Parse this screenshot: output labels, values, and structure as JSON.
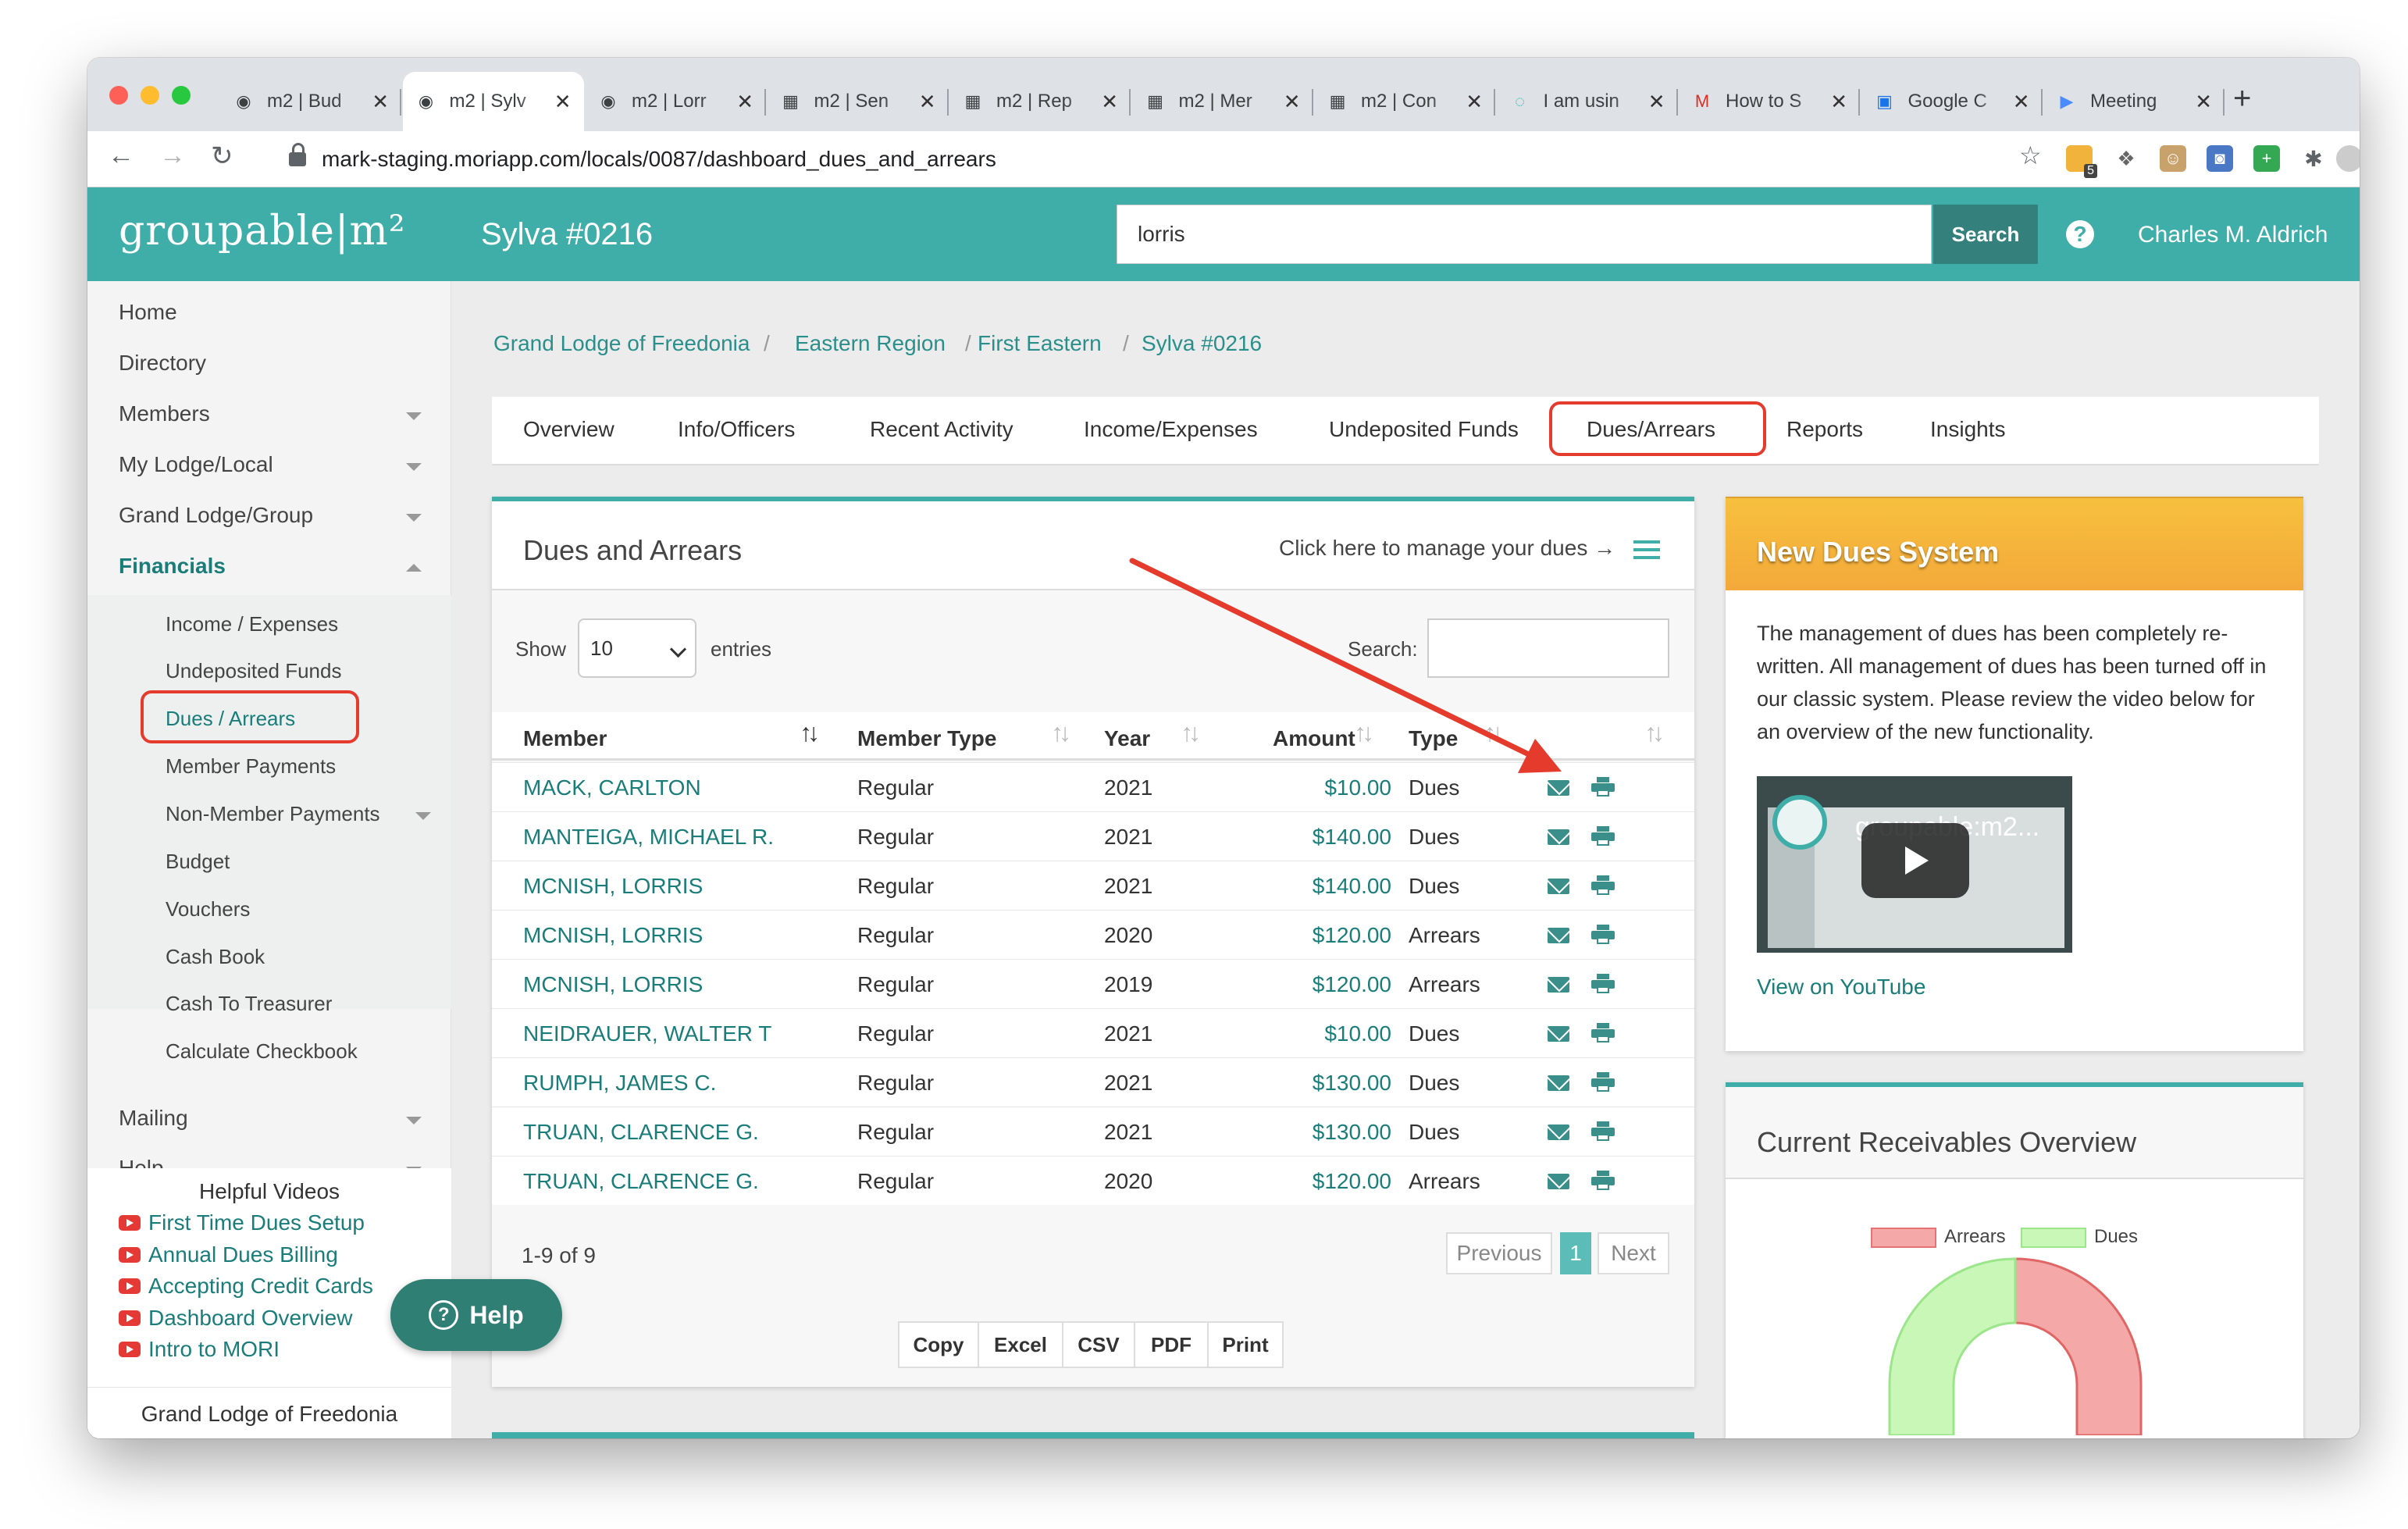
{
  "browser": {
    "tabs": [
      {
        "title": "m2 | Bud",
        "icon": "globe-icon",
        "active": false
      },
      {
        "title": "m2 | Sylv",
        "icon": "globe-icon",
        "active": true
      },
      {
        "title": "m2 | Lorr",
        "icon": "globe-icon",
        "active": false
      },
      {
        "title": "m2 | Sen",
        "icon": "qr-icon",
        "active": false
      },
      {
        "title": "m2 | Rep",
        "icon": "qr-icon",
        "active": false
      },
      {
        "title": "m2 | Mer",
        "icon": "qr-icon",
        "active": false
      },
      {
        "title": "m2 | Con",
        "icon": "qr-icon",
        "active": false
      },
      {
        "title": "I am usin",
        "icon": "swirl-icon",
        "active": false
      },
      {
        "title": "How to S",
        "icon": "gmail-icon",
        "active": false
      },
      {
        "title": "Google C",
        "icon": "calendar-icon",
        "active": false
      },
      {
        "title": "Meeting",
        "icon": "video-icon",
        "active": false
      }
    ],
    "url": "mark-staging.moriapp.com/locals/0087/dashboard_dues_and_arrears",
    "extension_badge": "5"
  },
  "header": {
    "logo": "groupable|m²",
    "lodge": "Sylva #0216",
    "search_value": "lorris",
    "search_button": "Search",
    "help_icon": "?",
    "user": "Charles M. Aldrich",
    "accent_color": "#3fada8"
  },
  "sidebar": {
    "items": [
      "Home",
      "Directory",
      "Members",
      "My Lodge/Local",
      "Grand Lodge/Group",
      "Financials"
    ],
    "financials_sub": [
      "Income / Expenses",
      "Undeposited Funds",
      "Dues / Arrears",
      "Member Payments",
      "Non-Member Payments",
      "Budget",
      "Vouchers",
      "Cash Book",
      "Cash To Treasurer",
      "Calculate Checkbook"
    ],
    "more": [
      "Mailing",
      "Help"
    ],
    "helpful_title": "Helpful Videos",
    "videos": [
      "First Time Dues Setup",
      "Annual Dues Billing",
      "Accepting Credit Cards",
      "Dashboard Overview",
      "Intro to MORI"
    ],
    "footer": "Grand Lodge of Freedonia"
  },
  "breadcrumb": [
    "Grand Lodge of Freedonia",
    "Eastern Region",
    "First Eastern",
    "Sylva #0216"
  ],
  "page_tabs": [
    "Overview",
    "Info/Officers",
    "Recent Activity",
    "Income/Expenses",
    "Undeposited Funds",
    "Dues/Arrears",
    "Reports",
    "Insights"
  ],
  "dues": {
    "title": "Dues and Arrears",
    "manage_link": "Click here to manage your dues →",
    "show_label": "Show",
    "show_value": "10",
    "entries_label": "entries",
    "search_label": "Search:",
    "columns": [
      "Member",
      "Member Type",
      "Year",
      "Amount",
      "Type"
    ],
    "rows": [
      {
        "member": "MACK, CARLTON",
        "type": "Regular",
        "year": "2021",
        "amount": "$10.00",
        "kind": "Dues"
      },
      {
        "member": "MANTEIGA, MICHAEL R.",
        "type": "Regular",
        "year": "2021",
        "amount": "$140.00",
        "kind": "Dues"
      },
      {
        "member": "MCNISH, LORRIS",
        "type": "Regular",
        "year": "2021",
        "amount": "$140.00",
        "kind": "Dues"
      },
      {
        "member": "MCNISH, LORRIS",
        "type": "Regular",
        "year": "2020",
        "amount": "$120.00",
        "kind": "Arrears"
      },
      {
        "member": "MCNISH, LORRIS",
        "type": "Regular",
        "year": "2019",
        "amount": "$120.00",
        "kind": "Arrears"
      },
      {
        "member": "NEIDRAUER, WALTER T",
        "type": "Regular",
        "year": "2021",
        "amount": "$10.00",
        "kind": "Dues"
      },
      {
        "member": "RUMPH, JAMES C.",
        "type": "Regular",
        "year": "2021",
        "amount": "$130.00",
        "kind": "Dues"
      },
      {
        "member": "TRUAN, CLARENCE G.",
        "type": "Regular",
        "year": "2021",
        "amount": "$130.00",
        "kind": "Dues"
      },
      {
        "member": "TRUAN, CLARENCE G.",
        "type": "Regular",
        "year": "2020",
        "amount": "$120.00",
        "kind": "Arrears"
      }
    ],
    "count": "1-9 of 9",
    "prev": "Previous",
    "page": "1",
    "next": "Next",
    "exports": [
      "Copy",
      "Excel",
      "CSV",
      "PDF",
      "Print"
    ]
  },
  "help_button": "Help",
  "new_dues": {
    "title": "New Dues System",
    "body": "The management of dues has been completely re-written. All management of dues has been turned off in our classic system. Please review the video below for an overview of the new functionality.",
    "video_title": "groupable:m2...",
    "youtube_link": "View on YouTube"
  },
  "receivables": {
    "title": "Current Receivables Overview",
    "legend": [
      "Arrears",
      "Dues"
    ],
    "colors": {
      "arrears": "#f4a8a8",
      "dues": "#b9f5a6"
    }
  },
  "annotation_color": "#e53b2c"
}
